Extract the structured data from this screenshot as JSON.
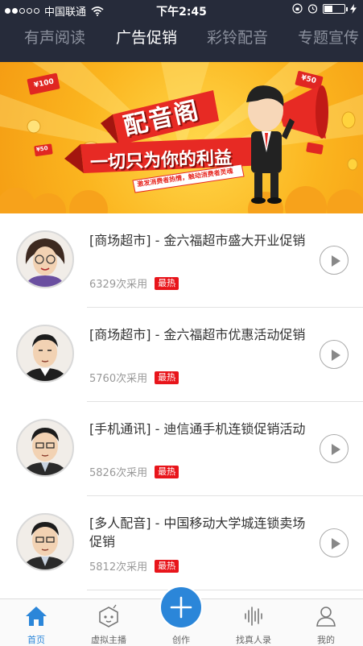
{
  "status_bar": {
    "carrier": "中国联通",
    "time": "下午2:45",
    "battery_level": 0.4
  },
  "tabs": [
    {
      "label": "有声阅读",
      "active": false
    },
    {
      "label": "广告促销",
      "active": true
    },
    {
      "label": "彩铃配音",
      "active": false
    },
    {
      "label": "专题宣传",
      "active": false
    }
  ],
  "banner": {
    "title": "配音阁",
    "slogan": "一切只为你的利益",
    "ribbon_text": "激发消费者热情，触动消费者灵魂",
    "coupon_left": "¥100",
    "coupon_right": "¥50",
    "coupon_small": "¥50"
  },
  "items": [
    {
      "title": "[商场超市] - 金六福超市盛大开业促销",
      "usage": "6329次采用",
      "badge": "最热"
    },
    {
      "title": "[商场超市] - 金六福超市优惠活动促销",
      "usage": "5760次采用",
      "badge": "最热"
    },
    {
      "title": "[手机通讯] - 迪信通手机连锁促销活动",
      "usage": "5826次采用",
      "badge": "最热"
    },
    {
      "title": "[多人配音] - 中国移动大学城连锁卖场促销",
      "usage": "5812次采用",
      "badge": "最热"
    }
  ],
  "bottom_nav": [
    {
      "label": "首页",
      "icon": "home-icon",
      "active": true
    },
    {
      "label": "虚拟主播",
      "icon": "robot-icon",
      "active": false
    },
    {
      "label": "创作",
      "icon": "plus-icon",
      "active": false
    },
    {
      "label": "找真人录",
      "icon": "soundwave-icon",
      "active": false
    },
    {
      "label": "我的",
      "icon": "user-icon",
      "active": false
    }
  ],
  "colors": {
    "header_bg": "#262b3a",
    "accent_blue": "#2b86d9",
    "badge_red": "#e8151b",
    "banner_yellow": "#fbb51f"
  }
}
